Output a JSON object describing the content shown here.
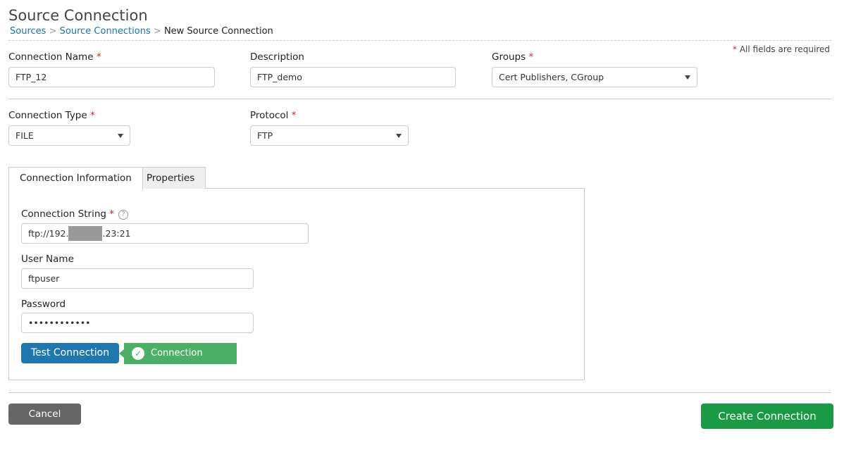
{
  "header": {
    "title": "Source Connection",
    "breadcrumb": [
      "Sources",
      "Source Connections",
      "New Source Connection"
    ],
    "separator": ">",
    "required_note": "All fields are required",
    "required_mark": "*"
  },
  "form": {
    "connection_name": {
      "label": "Connection Name",
      "value": "FTP_12"
    },
    "description": {
      "label": "Description",
      "value": "FTP_demo"
    },
    "groups": {
      "label": "Groups",
      "value": "Cert Publishers,  CGroup"
    },
    "connection_type": {
      "label": "Connection Type",
      "value": "FILE"
    },
    "protocol": {
      "label": "Protocol",
      "value": "FTP"
    }
  },
  "tabs": [
    {
      "label": "Connection Information",
      "active": true
    },
    {
      "label": "Properties",
      "active": false
    }
  ],
  "connection_info": {
    "connection_string": {
      "label": "Connection String",
      "value_prefix": "ftp://192.",
      "value_suffix": ".23:21",
      "help": "?"
    },
    "user_name": {
      "label": "User Name",
      "value": "ftpuser"
    },
    "password": {
      "label": "Password",
      "value": "••••••••••••"
    },
    "test_button": "Test Connection",
    "status": "Connection verified"
  },
  "footer": {
    "cancel": "Cancel",
    "create": "Create Connection"
  },
  "colors": {
    "link": "#1a73a8",
    "primary": "#1f78ad",
    "success": "#4caf66",
    "create": "#1a9a45",
    "required": "#d0262d"
  }
}
